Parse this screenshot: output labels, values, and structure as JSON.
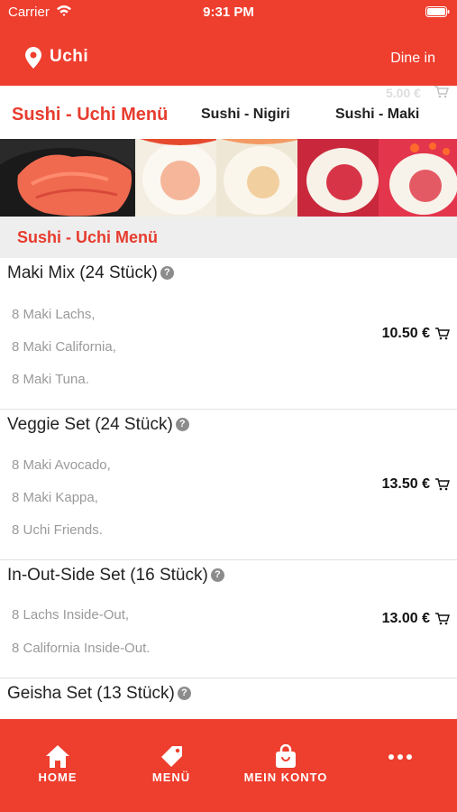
{
  "status_bar": {
    "carrier": "Carrier",
    "time": "9:31 PM"
  },
  "header": {
    "brand": "Uchi",
    "mode": "Dine in"
  },
  "tabs": {
    "items": [
      "Sushi - Uchi Menü",
      "Sushi - Nigiri",
      "Sushi - Maki"
    ],
    "ghost_price": "5.00 €"
  },
  "section": {
    "title": "Sushi - Uchi Menü"
  },
  "items": [
    {
      "title": "Maki Mix (24 Stück)",
      "desc": [
        "8 Maki Lachs,",
        "8 Maki California,",
        "8 Maki Tuna."
      ],
      "price": "10.50 €"
    },
    {
      "title": "Veggie Set (24 Stück)",
      "desc": [
        "8 Maki Avocado,",
        "8 Maki Kappa,",
        "8 Uchi Friends."
      ],
      "price": "13.50 €"
    },
    {
      "title": "In-Out-Side Set (16 Stück)",
      "desc": [
        "8 Lachs Inside-Out,",
        "8 California Inside-Out."
      ],
      "price": "13.00 €"
    },
    {
      "title": "Geisha Set (13 Stück)",
      "desc": [],
      "price": ""
    }
  ],
  "bottom_nav": {
    "home": "HOME",
    "menu": "MENÜ",
    "account": "MEIN KONTO",
    "more_icon": "more-dots-icon"
  },
  "colors": {
    "brand_red": "#ee3e2e",
    "section_bg": "#eeeeee",
    "desc_gray": "#9a9a9a"
  }
}
